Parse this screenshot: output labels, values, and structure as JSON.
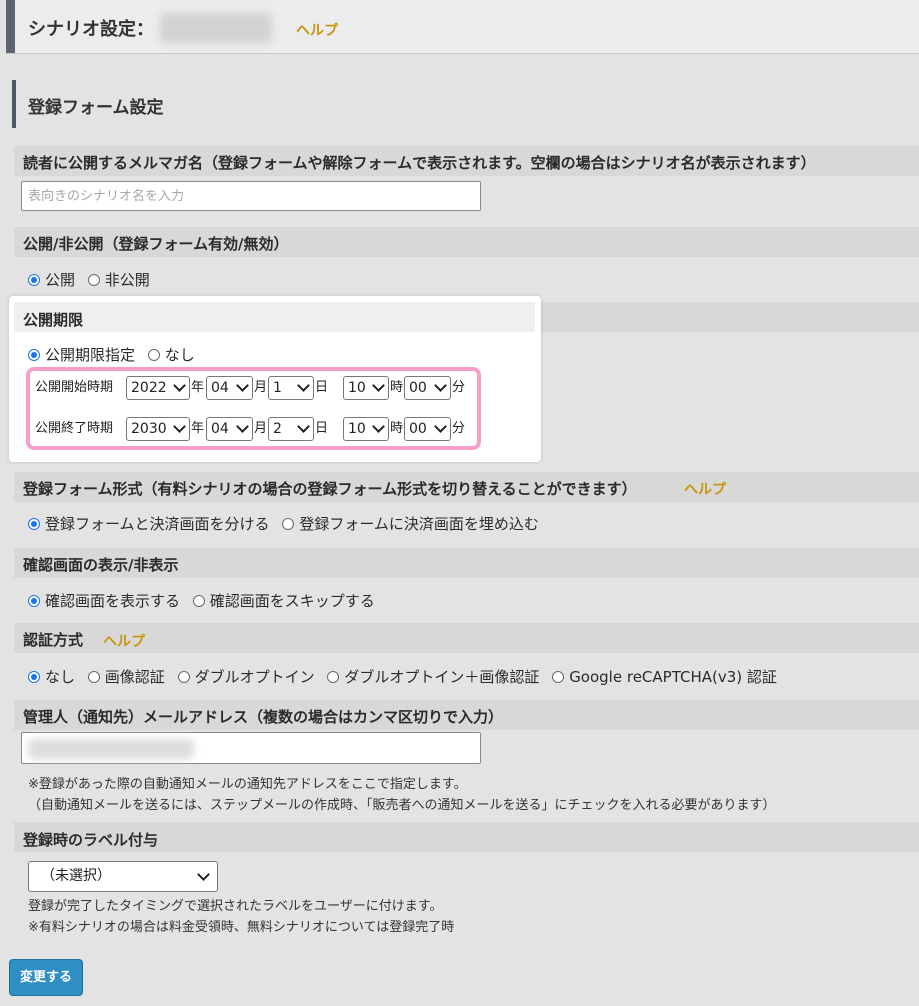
{
  "header": {
    "title": "シナリオ設定：",
    "help": "ヘルプ"
  },
  "section": {
    "title": "登録フォーム設定"
  },
  "magazine_name": {
    "label": "読者に公開するメルマガ名（登録フォームや解除フォームで表示されます。空欄の場合はシナリオ名が表示されます）",
    "placeholder": "表向きのシナリオ名を入力"
  },
  "publish": {
    "label": "公開/非公開（登録フォーム有効/無効）",
    "options": [
      {
        "label": "公開",
        "checked": true
      },
      {
        "label": "非公開",
        "checked": false
      }
    ]
  },
  "period": {
    "label": "公開期限",
    "options": [
      {
        "label": "公開期限指定",
        "checked": true
      },
      {
        "label": "なし",
        "checked": false
      }
    ],
    "start": {
      "label": "公開開始時期",
      "year": "2022",
      "month": "04",
      "day": "1",
      "hour": "10",
      "minute": "00"
    },
    "end": {
      "label": "公開終了時期",
      "year": "2030",
      "month": "04",
      "day": "2",
      "hour": "10",
      "minute": "00"
    },
    "units": {
      "year": "年",
      "month": "月",
      "day": "日",
      "hour": "時",
      "minute": "分"
    }
  },
  "form_type": {
    "label": "登録フォーム形式（有料シナリオの場合の登録フォーム形式を切り替えることができます）",
    "help": "ヘルプ",
    "options": [
      {
        "label": "登録フォームと決済画面を分ける",
        "checked": true
      },
      {
        "label": "登録フォームに決済画面を埋め込む",
        "checked": false
      }
    ]
  },
  "confirm": {
    "label": "確認画面の表示/非表示",
    "options": [
      {
        "label": "確認画面を表示する",
        "checked": true
      },
      {
        "label": "確認画面をスキップする",
        "checked": false
      }
    ]
  },
  "auth": {
    "label": "認証方式",
    "help": "ヘルプ",
    "options": [
      {
        "label": "なし",
        "checked": true
      },
      {
        "label": "画像認証",
        "checked": false
      },
      {
        "label": "ダブルオプトイン",
        "checked": false
      },
      {
        "label": "ダブルオプトイン＋画像認証",
        "checked": false
      },
      {
        "label": "Google reCAPTCHA(v3) 認証",
        "checked": false
      }
    ]
  },
  "admin_email": {
    "label": "管理人（通知先）メールアドレス（複数の場合はカンマ区切りで入力）",
    "note1": "※登録があった際の自動通知メールの通知先アドレスをここで指定します。",
    "note2": "（自動通知メールを送るには、ステップメールの作成時、「販売者への通知メールを送る」にチェックを入れる必要があります）"
  },
  "label_assign": {
    "label": "登録時のラベル付与",
    "selected": "（未選択）",
    "note1": "登録が完了したタイミングで選択されたラベルをユーザーに付けます。",
    "note2": "※有料シナリオの場合は料金受領時、無料シナリオについては登録完了時"
  },
  "submit": {
    "label": "変更する"
  },
  "colors": {
    "accent": "#1a73e8",
    "help": "#c8940a",
    "highlight": "#f6a0c8",
    "button": "#2f8fc5"
  }
}
